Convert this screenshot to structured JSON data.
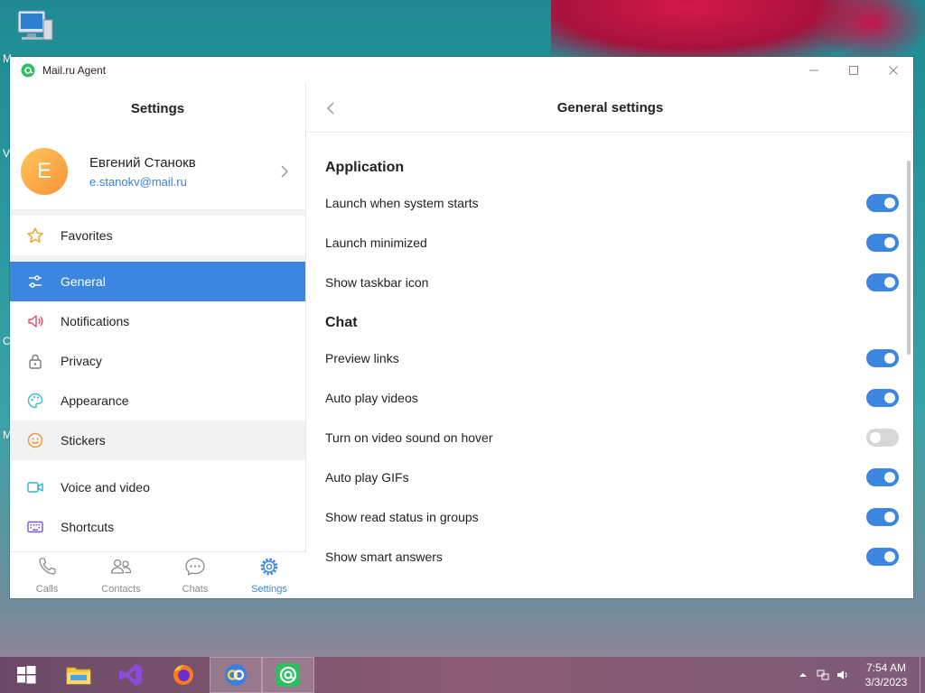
{
  "window": {
    "title": "Mail.ru Agent",
    "controls": {
      "minimize": "—",
      "maximize": "☐",
      "close": "✕"
    }
  },
  "sidebar": {
    "title": "Settings",
    "profile": {
      "initial": "E",
      "name": "Евгений Станокв",
      "email": "e.stanokv@mail.ru"
    },
    "items": [
      {
        "label": "Favorites",
        "icon": "star-icon"
      },
      {
        "label": "General",
        "icon": "sliders-icon",
        "active": true
      },
      {
        "label": "Notifications",
        "icon": "speaker-icon"
      },
      {
        "label": "Privacy",
        "icon": "lock-icon"
      },
      {
        "label": "Appearance",
        "icon": "palette-icon"
      },
      {
        "label": "Stickers",
        "icon": "smiley-icon"
      },
      {
        "label": "Voice and video",
        "icon": "camera-icon"
      },
      {
        "label": "Shortcuts",
        "icon": "keyboard-icon"
      }
    ]
  },
  "bottom_nav": {
    "calls": "Calls",
    "contacts": "Contacts",
    "chats": "Chats",
    "settings": "Settings"
  },
  "content": {
    "title": "General settings",
    "sections": [
      {
        "title": "Application",
        "settings": [
          {
            "label": "Launch when system starts",
            "enabled": true
          },
          {
            "label": "Launch minimized",
            "enabled": true
          },
          {
            "label": "Show taskbar icon",
            "enabled": true
          }
        ]
      },
      {
        "title": "Chat",
        "settings": [
          {
            "label": "Preview links",
            "enabled": true
          },
          {
            "label": "Auto play videos",
            "enabled": true
          },
          {
            "label": "Turn on video sound on hover",
            "enabled": false
          },
          {
            "label": "Auto play GIFs",
            "enabled": true
          },
          {
            "label": "Show read status in groups",
            "enabled": true
          },
          {
            "label": "Show smart answers",
            "enabled": true
          }
        ]
      }
    ]
  },
  "desktop": {
    "fragments": [
      "M",
      "V",
      "C",
      "M"
    ]
  },
  "taskbar": {
    "time": "7:54 AM",
    "date": "3/3/2023"
  },
  "colors": {
    "accent": "#3d86e0",
    "toggle_off": "#d7d7da",
    "email": "#3b7fd8"
  }
}
